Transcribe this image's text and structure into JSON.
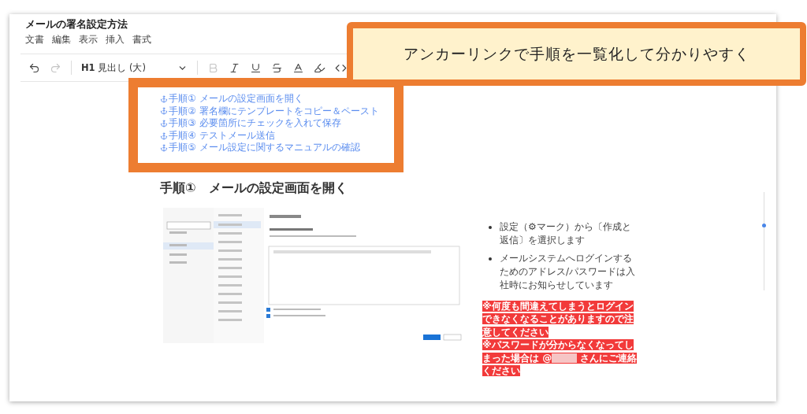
{
  "document": {
    "title": "メールの署名設定方法",
    "menu": [
      "文書",
      "編集",
      "表示",
      "挿入",
      "書式"
    ]
  },
  "toolbar": [
    {
      "kind": "undo",
      "disabled": false
    },
    {
      "kind": "redo",
      "disabled": true
    },
    {
      "kind": "style",
      "label": "H1",
      "value": "見出し (大)"
    },
    {
      "kind": "bold",
      "disabled": true
    },
    {
      "kind": "italic",
      "disabled": false
    },
    {
      "kind": "underline",
      "disabled": false
    },
    {
      "kind": "strike",
      "disabled": false
    },
    {
      "kind": "color",
      "disabled": false
    },
    {
      "kind": "highlight",
      "disabled": false
    },
    {
      "kind": "code",
      "disabled": false
    }
  ],
  "anchor_links": [
    "手順① メールの設定画面を開く",
    "手順② 署名欄にテンプレートをコピー＆ペースト",
    "手順③ 必要箇所にチェックを入れて保存",
    "手順④ テストメール送信",
    "手順⑤ メール設定に関するマニュアルの確認"
  ],
  "heading": "手順①　メールの設定画面を開く",
  "bullets": [
    "設定（⚙マーク）から〔作成と返信〕を選択します",
    "メールシステムへログインするためのアドレス/パスワードは入社時にお知らせしています"
  ],
  "warnings": [
    {
      "before": "※何度も間違えてしまうとログインできなくなることがありますので注意してください",
      "redacted": false
    },
    {
      "before": "※パスワードが分からなくなってしまった場合は @",
      "redacted": true,
      "after": "さんにご連絡ください"
    }
  ],
  "callout": "アンカーリンクで手順を一覧化して分かりやすく"
}
